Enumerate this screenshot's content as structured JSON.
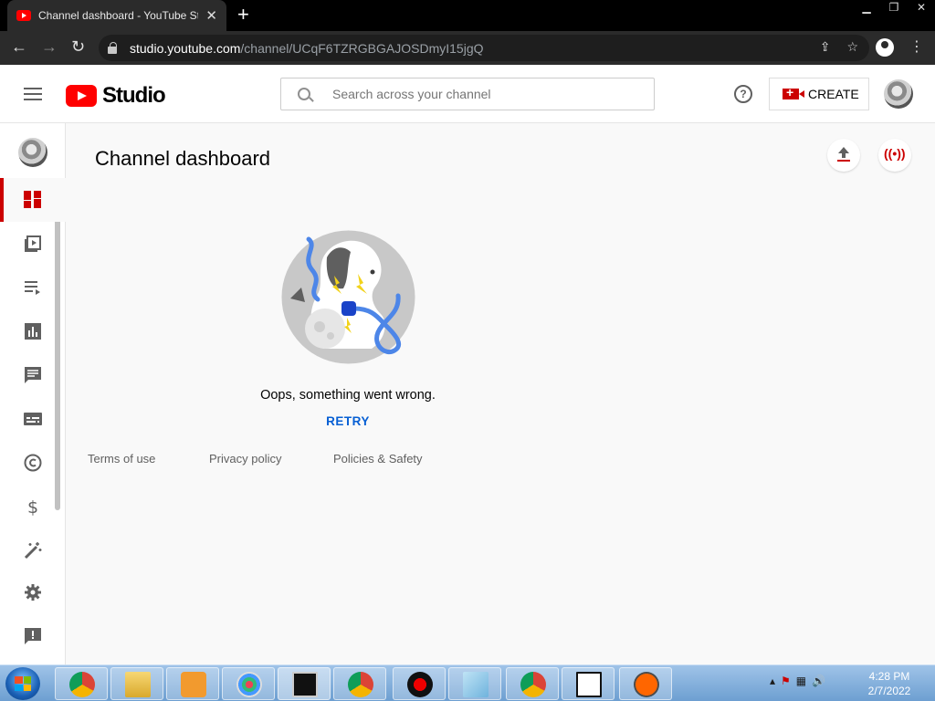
{
  "browser": {
    "tab_title": "Channel dashboard - YouTube Studio",
    "url_host": "studio.youtube.com",
    "url_path": "/channel/UCqF6TZRGBGAJOSDmyI15jgQ"
  },
  "header": {
    "logo_text": "Studio",
    "search_placeholder": "Search across your channel",
    "create_label": "CREATE"
  },
  "sidebar": {
    "items": [
      {
        "name": "dashboard",
        "icon": "dashboard-icon",
        "active": true
      },
      {
        "name": "content",
        "icon": "video-library-icon"
      },
      {
        "name": "playlists",
        "icon": "playlist-icon"
      },
      {
        "name": "analytics",
        "icon": "analytics-icon"
      },
      {
        "name": "comments",
        "icon": "comment-icon"
      },
      {
        "name": "subtitles",
        "icon": "subtitles-icon"
      },
      {
        "name": "copyright",
        "icon": "copyright-icon"
      },
      {
        "name": "earn",
        "icon": "dollar-icon"
      },
      {
        "name": "customization",
        "icon": "magic-wand-icon"
      },
      {
        "name": "settings",
        "icon": "gear-icon"
      },
      {
        "name": "feedback",
        "icon": "feedback-icon"
      }
    ]
  },
  "main": {
    "page_title": "Channel dashboard",
    "error_message": "Oops, something went wrong.",
    "retry_label": "RETRY",
    "footer_links": [
      "Terms of use",
      "Privacy policy",
      "Policies & Safety"
    ]
  },
  "taskbar": {
    "time": "4:28 PM",
    "date": "2/7/2022",
    "apps": [
      "chrome",
      "file-explorer",
      "media-player",
      "paint",
      "command-prompt",
      "chrome-profile",
      "recorder",
      "notepad",
      "chrome-secure",
      "7zip",
      "monero"
    ]
  },
  "colors": {
    "brand_red": "#ff0000",
    "accent_red": "#cc0000",
    "link_blue": "#065fd4"
  }
}
